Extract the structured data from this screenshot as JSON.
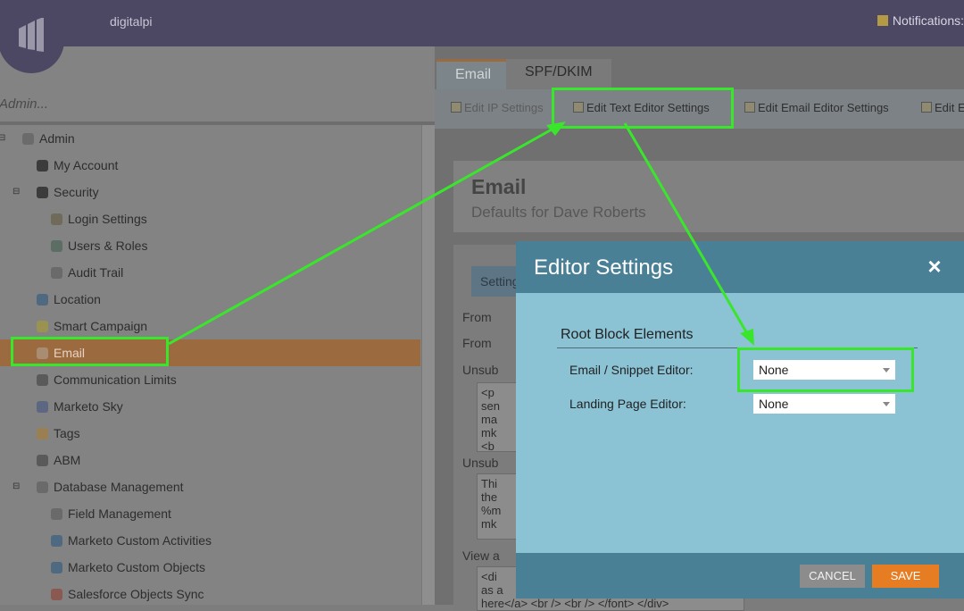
{
  "topbar": {
    "brand": "digitalpi",
    "notifications": "Notifications:"
  },
  "sidebar": {
    "search_placeholder": "Admin...",
    "items": [
      {
        "label": "Admin",
        "toggle": "⊟",
        "icon_color": "#6b6b6b",
        "icon": "gear-icon"
      },
      {
        "label": "My Account",
        "icon_color": "#3c3c3c",
        "icon": "user-icon"
      },
      {
        "label": "Security",
        "toggle": "⊟",
        "icon_color": "#3c3c3c",
        "icon": "lock-icon"
      },
      {
        "label": "Login Settings",
        "icon_color": "#6f6a5a",
        "icon": "key-icon"
      },
      {
        "label": "Users & Roles",
        "icon_color": "#5c6d63",
        "icon": "users-icon"
      },
      {
        "label": "Audit Trail",
        "icon_color": "#6a6a6a",
        "icon": "audit-icon"
      },
      {
        "label": "Location",
        "icon_color": "#4f6a80",
        "icon": "globe-icon"
      },
      {
        "label": "Smart Campaign",
        "icon_color": "#9a9250",
        "icon": "lightbulb-icon"
      },
      {
        "label": "Email",
        "icon_color": "#a88d72",
        "icon": "email-icon",
        "selected": true
      },
      {
        "label": "Communication Limits",
        "icon_color": "#5a5a5a",
        "icon": "at-icon"
      },
      {
        "label": "Marketo Sky",
        "icon_color": "#5c6782",
        "icon": "bird-icon"
      },
      {
        "label": "Tags",
        "icon_color": "#9a7f52",
        "icon": "tag-icon"
      },
      {
        "label": "ABM",
        "icon_color": "#5a5a5a",
        "icon": "target-icon"
      },
      {
        "label": "Database Management",
        "toggle": "⊟",
        "icon_color": "#6a6a6a",
        "icon": "database-icon"
      },
      {
        "label": "Field Management",
        "icon_color": "#6a6a6a",
        "icon": "field-icon"
      },
      {
        "label": "Marketo Custom Activities",
        "icon_color": "#4f6a80",
        "icon": "activities-icon"
      },
      {
        "label": "Marketo Custom Objects",
        "icon_color": "#4f6a80",
        "icon": "objects-icon"
      },
      {
        "label": "Salesforce Objects Sync",
        "icon_color": "#8a5a52",
        "icon": "sync-icon"
      }
    ]
  },
  "main": {
    "tabs": [
      {
        "label": "Email"
      },
      {
        "label": "SPF/DKIM"
      }
    ],
    "toolbar": {
      "edit_ip": "Edit IP Settings",
      "edit_text_editor": "Edit Text Editor Settings",
      "edit_email_editor": "Edit Email Editor Settings",
      "edit_more": "Edit E"
    },
    "panel": {
      "title": "Email",
      "subtitle": "Defaults for Dave Roberts"
    },
    "settings": {
      "tab": "Setting",
      "from1": "From",
      "from2": "From",
      "unsub1": "Unsub",
      "box1": [
        "<p",
        "sen",
        "ma",
        "mk",
        "<b"
      ],
      "unsub2": "Unsub",
      "box2": [
        "Thi",
        "the",
        "%m",
        "mk"
      ],
      "view": "View a",
      "box3": [
        "<di",
        "as a",
        "here</a> <br /> <br /> </font> </div>"
      ]
    }
  },
  "modal": {
    "title": "Editor Settings",
    "close": "×",
    "section_title": "Root Block Elements",
    "email_snippet_label": "Email / Snippet Editor:",
    "email_snippet_value": "None",
    "landing_page_label": "Landing Page Editor:",
    "landing_page_value": "None",
    "cancel": "CANCEL",
    "save": "SAVE"
  },
  "colors": {
    "highlight": "#39e62c",
    "save": "#e77d22",
    "modal_header": "#4a8096",
    "modal_body": "#8bc3d5"
  }
}
